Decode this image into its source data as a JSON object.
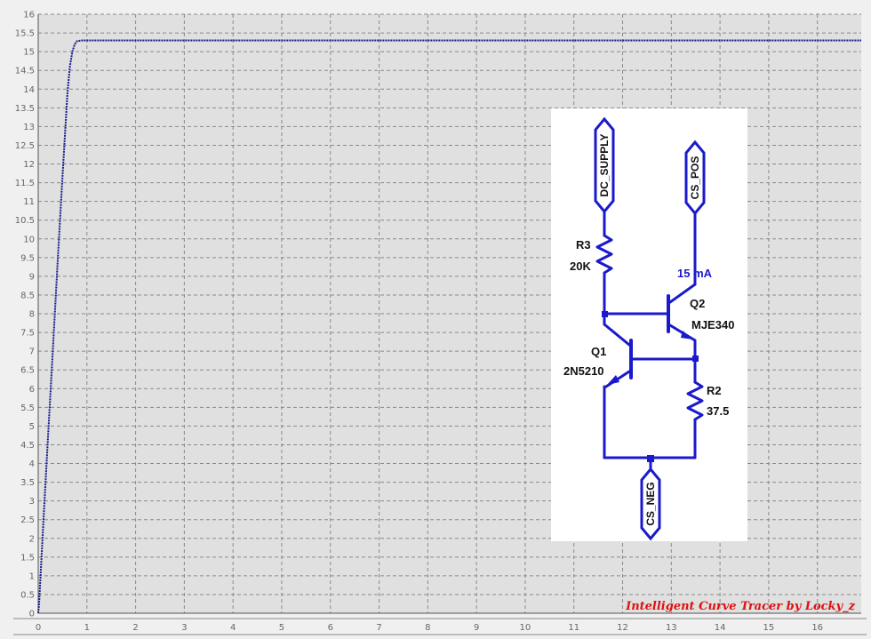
{
  "chart_data": {
    "type": "line",
    "x_ticks": [
      "0",
      "1",
      "2",
      "3",
      "4",
      "5",
      "6",
      "7",
      "8",
      "9",
      "10",
      "11",
      "12",
      "13",
      "14",
      "15",
      "16"
    ],
    "y_ticks": [
      "0",
      "0.5",
      "1",
      "1.5",
      "2",
      "2.5",
      "3",
      "3.5",
      "4",
      "4.5",
      "5",
      "5.5",
      "6",
      "6.5",
      "7",
      "7.5",
      "8",
      "8.5",
      "9",
      "9.5",
      "10",
      "10.5",
      "11",
      "11.5",
      "12",
      "12.5",
      "13",
      "13.5",
      "14",
      "14.5",
      "15",
      "15.5",
      "16"
    ],
    "xlim": [
      0,
      16.9
    ],
    "ylim": [
      0,
      16
    ],
    "grid": true,
    "series": [
      {
        "color": "#1a1a8c",
        "x": [
          0,
          0.02,
          0.1,
          0.2,
          0.3,
          0.4,
          0.5,
          0.6,
          0.65,
          0.7,
          0.75,
          0.8,
          0.9,
          1.0,
          2,
          4,
          8,
          12,
          16.9
        ],
        "y": [
          0,
          0.3,
          2.3,
          4.7,
          7.0,
          9.4,
          11.7,
          13.9,
          14.6,
          15.0,
          15.2,
          15.28,
          15.3,
          15.3,
          15.3,
          15.3,
          15.3,
          15.3,
          15.3
        ]
      }
    ]
  },
  "schematic": {
    "ports": {
      "dc_supply": "DC_SUPPLY",
      "cs_pos": "CS_POS",
      "cs_neg": "CS_NEG"
    },
    "r3_name": "R3",
    "r3_value": "20K",
    "r2_name": "R2",
    "r2_value": "37.5",
    "q1_name": "Q1",
    "q1_part": "2N5210",
    "q2_name": "Q2",
    "q2_part": "MJE340",
    "current": "15 mA",
    "wire_color": "#1a1acc"
  },
  "watermark": "Intelligent Curve Tracer by Locky_z"
}
